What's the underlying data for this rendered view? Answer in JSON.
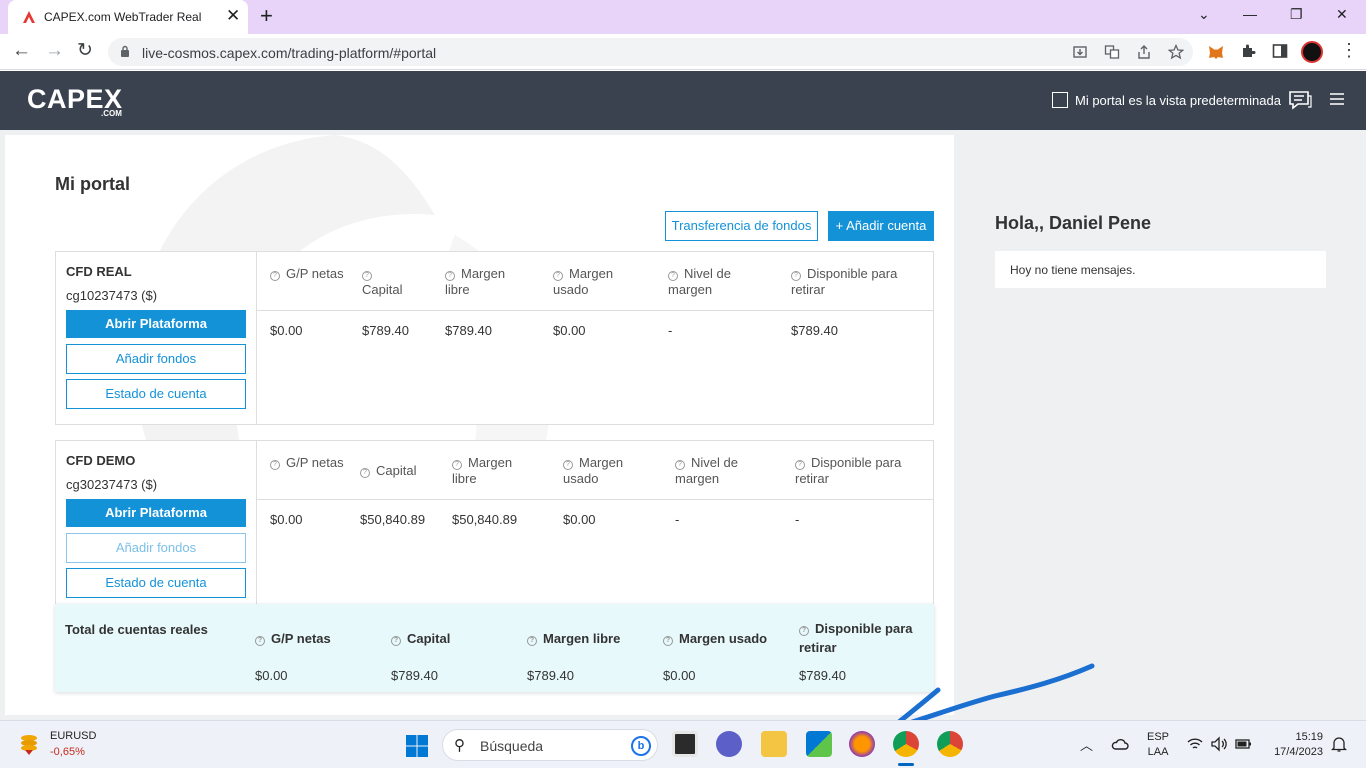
{
  "browser": {
    "tab_title": "CAPEX.com WebTrader Real",
    "tab_close": "✕",
    "new_tab": "+",
    "url": "live-cosmos.capex.com/trading-platform/#portal",
    "window_controls": {
      "minimize": "⌄",
      "restore": "—",
      "maximize": "❐",
      "close": "✕"
    },
    "nav": {
      "back": "←",
      "forward": "→",
      "reload": "↻"
    }
  },
  "header": {
    "logo": "CAPEX",
    "logo_sub": ".COM",
    "default_view_label": "Mi portal es la vista predeterminada",
    "default_view_checked": false
  },
  "portal": {
    "title": "Mi portal",
    "transfer_button": "Transferencia de fondos",
    "add_account_button": "+ Añadir cuenta",
    "accounts": [
      {
        "name": "CFD REAL",
        "id": "cg10237473 ($)",
        "open_label": "Abrir Plataforma",
        "add_funds_label": "Añadir fondos",
        "statement_label": "Estado de cuenta",
        "headers": [
          "G/P netas",
          "Capital",
          "Margen libre",
          "Margen usado",
          "Nivel de margen",
          "Disponible para retirar"
        ],
        "values": [
          "$0.00",
          "$789.40",
          "$789.40",
          "$0.00",
          "-",
          "$789.40"
        ]
      },
      {
        "name": "CFD DEMO",
        "id": "cg30237473 ($)",
        "open_label": "Abrir Plataforma",
        "add_funds_label": "Añadir fondos",
        "statement_label": "Estado de cuenta",
        "headers": [
          "G/P netas",
          "Capital",
          "Margen libre",
          "Margen usado",
          "Nivel de margen",
          "Disponible para retirar"
        ],
        "values": [
          "$0.00",
          "$50,840.89",
          "$50,840.89",
          "$0.00",
          "-",
          "-"
        ]
      }
    ],
    "totals": {
      "title": "Total de cuentas reales",
      "headers": [
        "G/P netas",
        "Capital",
        "Margen libre",
        "Margen usado",
        "Disponible para retirar"
      ],
      "values": [
        "$0.00",
        "$789.40",
        "$789.40",
        "$0.00",
        "$789.40"
      ]
    }
  },
  "sidebar": {
    "greeting": "Hola,, Daniel Pene",
    "messages": "Hoy no tiene mensajes."
  },
  "taskbar": {
    "ticker_name": "EURUSD",
    "ticker_change": "-0,65%",
    "search_placeholder": "Búsqueda",
    "search_glyph": "⚲",
    "lang_top": "ESP",
    "lang_bottom": "LAA",
    "time": "15:19",
    "date": "17/4/2023"
  },
  "colors": {
    "accent": "#1492d8",
    "header_bg": "#3a4250",
    "totals_bg": "#e8f9fb",
    "annotation": "#1a6fd1"
  }
}
